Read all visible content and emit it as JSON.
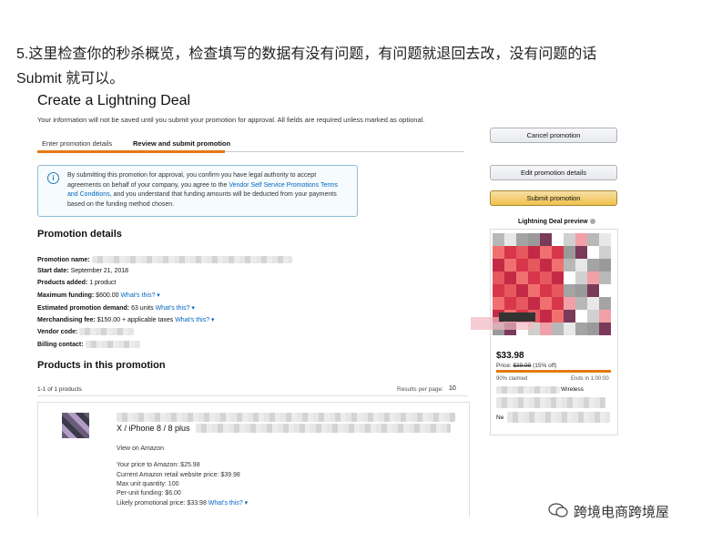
{
  "caption": {
    "line1": "5.这里检查你的秒杀概览，检查填写的数据有没有问题，有问题就退回去改，没有问题的话",
    "line2": "Submit 就可以。"
  },
  "page": {
    "title": "Create a Lightning Deal",
    "subtitle": "Your information will not be saved until you submit your promotion for approval. All fields are required unless marked as optional."
  },
  "tabs": [
    {
      "label": "Enter promotion details",
      "active": false
    },
    {
      "label": "Review and submit promotion",
      "active": true
    }
  ],
  "info_box": {
    "text_before": "By submitting this promotion for approval, you confirm you have legal authority to accept agreements on behalf of your company, you agree to the ",
    "link_text": "Vendor Self Service Promotions Terms and Conditions",
    "text_after": ", and you understand that funding amounts will be deducted from your payments based on the funding method chosen."
  },
  "buttons": {
    "cancel": "Cancel promotion",
    "edit": "Edit promotion details",
    "submit": "Submit promotion"
  },
  "preview": {
    "heading": "Lightning Deal preview",
    "price": "$33.98",
    "price_label": "Price:",
    "old_price": "$39.98",
    "discount": "(15% off)",
    "claimed": "90% claimed",
    "ends": "Ends in 1:00:00",
    "wireless_fragment": "Wireless",
    "bottom_fragment": "Ne"
  },
  "promotion_details": {
    "heading": "Promotion details",
    "rows": [
      {
        "label": "Promotion name:",
        "value": "",
        "link": ""
      },
      {
        "label": "Start date:",
        "value": "September 21, 2018",
        "link": ""
      },
      {
        "label": "Products added:",
        "value": "1 product",
        "link": ""
      },
      {
        "label": "Maximum funding:",
        "value": "$600.00",
        "link": "What's this?"
      },
      {
        "label": "Estimated promotion demand:",
        "value": "63 units",
        "link": "What's this?"
      },
      {
        "label": "Merchandising fee:",
        "value": "$150.00 + applicable taxes",
        "link": "What's this?"
      },
      {
        "label": "Vendor code:",
        "value": "",
        "link": ""
      },
      {
        "label": "Billing contact:",
        "value": "",
        "link": ""
      }
    ]
  },
  "products": {
    "heading": "Products in this promotion",
    "count": "1-1 of 1 products",
    "per_page_label": "Results per page:",
    "per_page_value": "10",
    "item": {
      "title_fragment": "X / iPhone 8 / 8 plus",
      "view_link": "View on Amazon",
      "lines": [
        "Your price to Amazon: $25.98",
        "Current Amazon retail website price: $39.98",
        "Max unit quantity: 100",
        "Per-unit funding: $6.00"
      ],
      "promo_price": "Likely promotional price: $33.98",
      "whats_this": "What's this?"
    }
  },
  "watermark": "跨境电商跨境屋",
  "colors": {
    "accent": "#e47911",
    "link": "#0066c0",
    "submit_button": "#f0c14b"
  }
}
